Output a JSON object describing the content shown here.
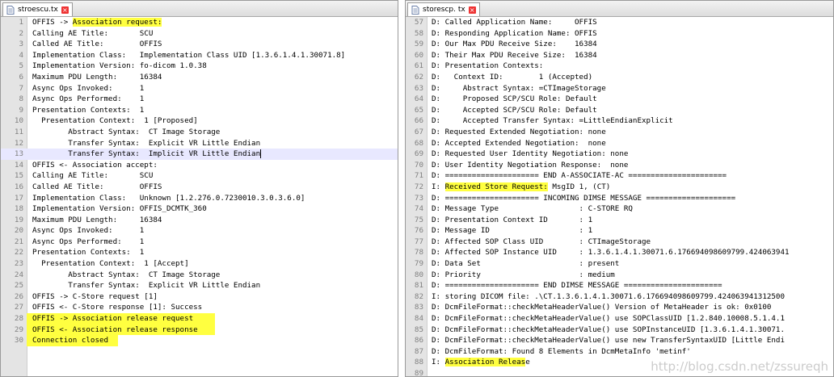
{
  "left_pane": {
    "tab_label": "stroescu.tx",
    "lines": [
      {
        "n": "1",
        "text": "OFFIS -> Association request:"
      },
      {
        "n": "2",
        "text": "Calling AE Title:       SCU"
      },
      {
        "n": "3",
        "text": "Called AE Title:        OFFIS"
      },
      {
        "n": "4",
        "text": "Implementation Class:   Implementation Class UID [1.3.6.1.4.1.30071.8]"
      },
      {
        "n": "5",
        "text": "Implementation Version: fo-dicom 1.0.38"
      },
      {
        "n": "6",
        "text": "Maximum PDU Length:     16384"
      },
      {
        "n": "7",
        "text": "Async Ops Invoked:      1"
      },
      {
        "n": "8",
        "text": "Async Ops Performed:    1"
      },
      {
        "n": "9",
        "text": "Presentation Contexts:  1"
      },
      {
        "n": "10",
        "text": "  Presentation Context:  1 [Proposed]"
      },
      {
        "n": "11",
        "text": "        Abstract Syntax:  CT Image Storage"
      },
      {
        "n": "12",
        "text": "        Transfer Syntax:  Explicit VR Little Endian"
      },
      {
        "n": "13",
        "text": "        Transfer Syntax:  Implicit VR Little Endian"
      },
      {
        "n": "14",
        "text": "OFFIS <- Association accept:"
      },
      {
        "n": "15",
        "text": "Calling AE Title:       SCU"
      },
      {
        "n": "16",
        "text": "Called AE Title:        OFFIS"
      },
      {
        "n": "17",
        "text": "Implementation Class:   Unknown [1.2.276.0.7230010.3.0.3.6.0]"
      },
      {
        "n": "18",
        "text": "Implementation Version: OFFIS_DCMTK_360"
      },
      {
        "n": "19",
        "text": "Maximum PDU Length:     16384"
      },
      {
        "n": "20",
        "text": "Async Ops Invoked:      1"
      },
      {
        "n": "21",
        "text": "Async Ops Performed:    1"
      },
      {
        "n": "22",
        "text": "Presentation Contexts:  1"
      },
      {
        "n": "23",
        "text": "  Presentation Context:  1 [Accept]"
      },
      {
        "n": "24",
        "text": "        Abstract Syntax:  CT Image Storage"
      },
      {
        "n": "25",
        "text": "        Transfer Syntax:  Explicit VR Little Endian"
      },
      {
        "n": "26",
        "text": "OFFIS -> C-Store request [1]"
      },
      {
        "n": "27",
        "text": "OFFIS <- C-Store response [1]: Success"
      },
      {
        "n": "28",
        "text": "OFFIS -> Association release request"
      },
      {
        "n": "29",
        "text": "OFFIS <- Association release response"
      },
      {
        "n": "30",
        "text": "Connection closed"
      }
    ]
  },
  "right_pane": {
    "tab_label": "storescp. tx",
    "lines": [
      {
        "n": "57",
        "text": "D: Called Application Name:     OFFIS"
      },
      {
        "n": "58",
        "text": "D: Responding Application Name: OFFIS"
      },
      {
        "n": "59",
        "text": "D: Our Max PDU Receive Size:    16384"
      },
      {
        "n": "60",
        "text": "D: Their Max PDU Receive Size:  16384"
      },
      {
        "n": "61",
        "text": "D: Presentation Contexts:"
      },
      {
        "n": "62",
        "text": "D:   Context ID:        1 (Accepted)"
      },
      {
        "n": "63",
        "text": "D:     Abstract Syntax: =CTImageStorage"
      },
      {
        "n": "64",
        "text": "D:     Proposed SCP/SCU Role: Default"
      },
      {
        "n": "65",
        "text": "D:     Accepted SCP/SCU Role: Default"
      },
      {
        "n": "66",
        "text": "D:     Accepted Transfer Syntax: =LittleEndianExplicit"
      },
      {
        "n": "67",
        "text": "D: Requested Extended Negotiation: none"
      },
      {
        "n": "68",
        "text": "D: Accepted Extended Negotiation:  none"
      },
      {
        "n": "69",
        "text": "D: Requested User Identity Negotiation: none"
      },
      {
        "n": "70",
        "text": "D: User Identity Negotiation Response:  none"
      },
      {
        "n": "71",
        "text": "D: ===================== END A-ASSOCIATE-AC ======================"
      },
      {
        "n": "72",
        "text": "I: Received Store Request: MsgID 1, (CT)"
      },
      {
        "n": "73",
        "text": "D: ===================== INCOMING DIMSE MESSAGE ===================="
      },
      {
        "n": "74",
        "text": "D: Message Type                  : C-STORE RQ"
      },
      {
        "n": "75",
        "text": "D: Presentation Context ID       : 1"
      },
      {
        "n": "76",
        "text": "D: Message ID                    : 1"
      },
      {
        "n": "77",
        "text": "D: Affected SOP Class UID        : CTImageStorage"
      },
      {
        "n": "78",
        "text": "D: Affected SOP Instance UID     : 1.3.6.1.4.1.30071.6.176694098609799.424063941"
      },
      {
        "n": "79",
        "text": "D: Data Set                      : present"
      },
      {
        "n": "80",
        "text": "D: Priority                      : medium"
      },
      {
        "n": "81",
        "text": "D: ===================== END DIMSE MESSAGE ======================"
      },
      {
        "n": "82",
        "text": "I: storing DICOM file: .\\CT.1.3.6.1.4.1.30071.6.176694098609799.424063941312500"
      },
      {
        "n": "83",
        "text": "D: DcmFileFormat::checkMetaHeaderValue() Version of MetaHeader is ok: 0x0100"
      },
      {
        "n": "84",
        "text": "D: DcmFileFormat::checkMetaHeaderValue() use SOPClassUID [1.2.840.10008.5.1.4.1"
      },
      {
        "n": "85",
        "text": "D: DcmFileFormat::checkMetaHeaderValue() use SOPInstanceUID [1.3.6.1.4.1.30071."
      },
      {
        "n": "86",
        "text": "D: DcmFileFormat::checkMetaHeaderValue() use new TransferSyntaxUID [Little Endi"
      },
      {
        "n": "87",
        "text": "D: DcmFileFormat: Found 8 Elements in DcmMetaInfo 'metinf'"
      },
      {
        "n": "88",
        "text": "I: Association Release"
      },
      {
        "n": "89",
        "text": ""
      }
    ]
  },
  "watermark": "http://blog.csdn.net/zssureqh",
  "colors": {
    "highlight": "#ffff40",
    "gutter": "#e4e4e4",
    "current_line": "#e8e8ff"
  }
}
